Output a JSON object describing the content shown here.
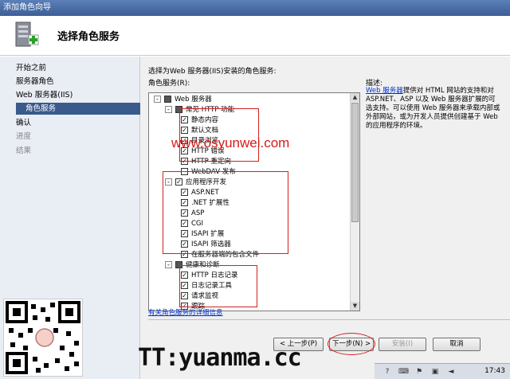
{
  "window": {
    "title": "添加角色向导"
  },
  "header": {
    "title": "选择角色服务"
  },
  "nav": {
    "items": [
      {
        "label": "开始之前",
        "state": "normal"
      },
      {
        "label": "服务器角色",
        "state": "normal"
      },
      {
        "label": "Web 服务器(IIS)",
        "state": "normal"
      },
      {
        "label": "角色服务",
        "state": "active"
      },
      {
        "label": "确认",
        "state": "normal"
      },
      {
        "label": "进度",
        "state": "disabled"
      },
      {
        "label": "结果",
        "state": "disabled"
      }
    ]
  },
  "content": {
    "prompt": "选择为Web 服务器(IIS)安装的角色服务:",
    "list_label": "角色服务(R):",
    "tree": [
      {
        "label": "Web 服务器",
        "level": 0,
        "expander": "-",
        "check": "partial"
      },
      {
        "label": "常见 HTTP 功能",
        "level": 1,
        "expander": "-",
        "check": "partial"
      },
      {
        "label": "静态内容",
        "level": 2,
        "check": "checked"
      },
      {
        "label": "默认文档",
        "level": 2,
        "check": "checked"
      },
      {
        "label": "目录浏览",
        "level": 2,
        "check": "checked"
      },
      {
        "label": "HTTP 错误",
        "level": 2,
        "check": "checked"
      },
      {
        "label": "HTTP 重定向",
        "level": 2,
        "check": "checked"
      },
      {
        "label": "WebDAV 发布",
        "level": 2,
        "check": "unchecked"
      },
      {
        "label": "应用程序开发",
        "level": 1,
        "expander": "-",
        "check": "checked"
      },
      {
        "label": "ASP.NET",
        "level": 2,
        "check": "checked"
      },
      {
        "label": ".NET 扩展性",
        "level": 2,
        "check": "checked"
      },
      {
        "label": "ASP",
        "level": 2,
        "check": "checked"
      },
      {
        "label": "CGI",
        "level": 2,
        "check": "checked"
      },
      {
        "label": "ISAPI 扩展",
        "level": 2,
        "check": "checked"
      },
      {
        "label": "ISAPI 筛选器",
        "level": 2,
        "check": "checked"
      },
      {
        "label": "在服务器端的包含文件",
        "level": 2,
        "check": "checked"
      },
      {
        "label": "健康和诊断",
        "level": 1,
        "expander": "-",
        "check": "partial"
      },
      {
        "label": "HTTP 日志记录",
        "level": 2,
        "check": "checked"
      },
      {
        "label": "日志记录工具",
        "level": 2,
        "check": "checked"
      },
      {
        "label": "请求监视",
        "level": 2,
        "check": "checked"
      },
      {
        "label": "跟踪",
        "level": 2,
        "check": "checked"
      }
    ],
    "description_label": "描述:",
    "description_link": "Web 服务器",
    "description_text": "提供对 HTML 网站的支持和对 ASP.NET、ASP 以及 Web 服务器扩展的可选支持。可以使用 Web 服务器来承载内部或外部网站，或为开发人员提供创建基于 Web 的应用程序的环境。",
    "more_link": "有关角色服务的详细信息"
  },
  "buttons": {
    "prev": "< 上一步(P)",
    "next": "下一步(N) >",
    "install": "安装(I)",
    "cancel": "取消"
  },
  "overlay": {
    "watermark": "www.osyunwei.com",
    "brand": "TT:yuanma.cc"
  },
  "taskbar": {
    "clock": "17:43"
  },
  "colors": {
    "accent": "#3b5a8c",
    "highlight_box": "#d42020",
    "link": "#0033cc"
  }
}
